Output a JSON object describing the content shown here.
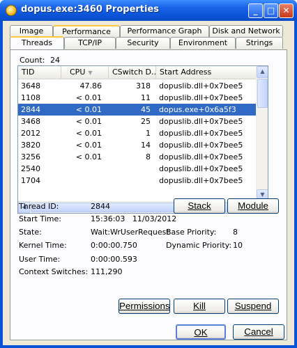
{
  "window": {
    "title": "dopus.exe:3460 Properties"
  },
  "tabs": {
    "row1": [
      "Image",
      "Performance",
      "Performance Graph",
      "Disk and Network"
    ],
    "row2": [
      "Threads",
      "TCP/IP",
      "Security",
      "Environment",
      "Strings"
    ]
  },
  "count": {
    "label": "Count:",
    "value": "24"
  },
  "list": {
    "columns": [
      "TID",
      "CPU",
      "CSwitch D...",
      "Start Address"
    ],
    "rows": [
      {
        "tid": "3648",
        "cpu": "47.86",
        "cswitch": "318",
        "start": "dopuslib.dll+0x7bee5"
      },
      {
        "tid": "1108",
        "cpu": "< 0.01",
        "cswitch": "11",
        "start": "dopuslib.dll+0x7bee5"
      },
      {
        "tid": "2844",
        "cpu": "< 0.01",
        "cswitch": "45",
        "start": "dopus.exe+0x6a5f3"
      },
      {
        "tid": "3468",
        "cpu": "< 0.01",
        "cswitch": "25",
        "start": "dopuslib.dll+0x7bee5"
      },
      {
        "tid": "2012",
        "cpu": "< 0.01",
        "cswitch": "1",
        "start": "dopuslib.dll+0x7bee5"
      },
      {
        "tid": "3820",
        "cpu": "< 0.01",
        "cswitch": "14",
        "start": "dopuslib.dll+0x7bee5"
      },
      {
        "tid": "3256",
        "cpu": "< 0.01",
        "cswitch": "8",
        "start": "dopuslib.dll+0x7bee5"
      },
      {
        "tid": "2540",
        "cpu": "",
        "cswitch": "",
        "start": "dopuslib.dll+0x7bee5"
      },
      {
        "tid": "1704",
        "cpu": "",
        "cswitch": "",
        "start": "dopuslib.dll+0x7bee5"
      }
    ]
  },
  "details": {
    "thread_id_label": "Thread ID:",
    "thread_id": "2844",
    "start_time_label": "Start Time:",
    "start_time": "15:36:03   11/03/2012",
    "state_label": "State:",
    "state": "Wait:WrUserRequest",
    "base_priority_label": "Base Priority:",
    "base_priority": "8",
    "kernel_time_label": "Kernel Time:",
    "kernel_time": "0:00:00.750",
    "dynamic_priority_label": "Dynamic Priority:",
    "dynamic_priority": "10",
    "user_time_label": "User Time:",
    "user_time": "0:00:00.593",
    "context_switches_label": "Context Switches:",
    "context_switches": "111,290"
  },
  "buttons": {
    "stack": "Stack",
    "module": "Module",
    "permissions": "Permissions",
    "kill": "Kill",
    "suspend": "Suspend",
    "ok": "OK",
    "cancel": "Cancel"
  },
  "colors": {
    "selection": "#316ac5",
    "titlebar": "#0b53d6",
    "tab_hot": "#ffc83c"
  },
  "icons": {
    "app": "dopus-app-icon"
  }
}
